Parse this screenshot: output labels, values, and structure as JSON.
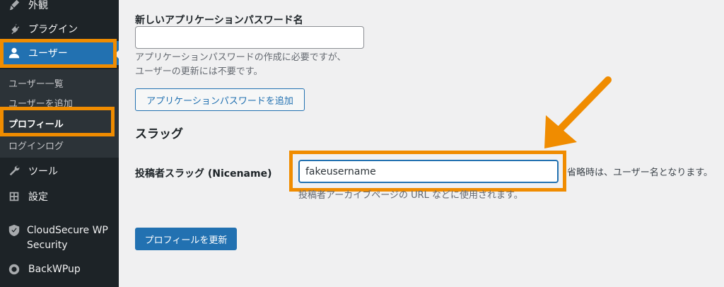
{
  "colors": {
    "sidebar_bg": "#1d2327",
    "submenu_bg": "#2c3338",
    "accent": "#2271b1",
    "highlight": "#f08c00",
    "page_bg": "#f0f0f1"
  },
  "sidebar": {
    "items": [
      {
        "label": "外観",
        "icon": "paintbrush-icon"
      },
      {
        "label": "プラグイン",
        "icon": "plugin-icon"
      },
      {
        "label": "ユーザー",
        "icon": "user-icon"
      },
      {
        "label": "ツール",
        "icon": "wrench-icon"
      },
      {
        "label": "設定",
        "icon": "settings-icon"
      },
      {
        "label": "CloudSecure WP",
        "label2": "Security",
        "icon": "shield-check-icon"
      },
      {
        "label": "BackWPup",
        "icon": "backwpup-icon"
      }
    ],
    "submenu": [
      {
        "label": "ユーザー一覧"
      },
      {
        "label": "ユーザーを追加"
      },
      {
        "label": "プロフィール"
      },
      {
        "label": "ログインログ"
      }
    ]
  },
  "main": {
    "app_password": {
      "label": "新しいアプリケーションパスワード名",
      "input_value": "",
      "desc_line1": "アプリケーションパスワードの作成に必要ですが、",
      "desc_line2": "ユーザーの更新には不要です。",
      "add_button": "アプリケーションパスワードを追加"
    },
    "slug": {
      "heading": "スラッグ",
      "label": "投稿者スラッグ (Nicename)",
      "input_value": "fakeusername",
      "side_note": "省略時は、ユーザー名となります。",
      "desc": "投稿者アーカイブページの URL などに使用されます。"
    },
    "update_button": "プロフィールを更新"
  }
}
